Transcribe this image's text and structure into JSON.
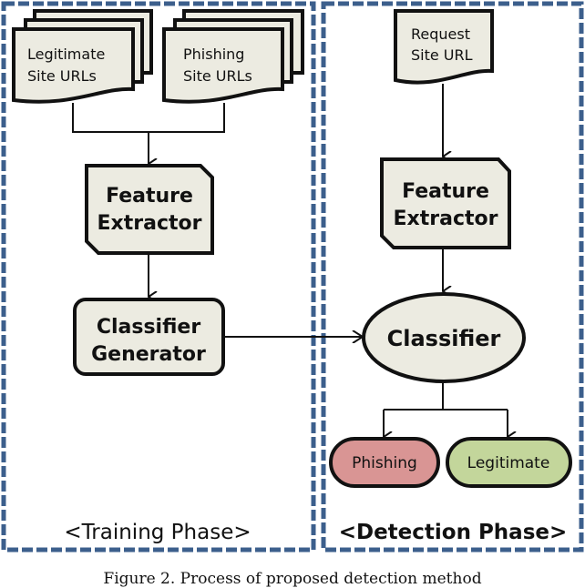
{
  "training_phase": {
    "title": "<Training Phase>",
    "legitimate_urls": {
      "line1": "Legitimate",
      "line2": "Site URLs"
    },
    "phishing_urls": {
      "line1": "Phishing",
      "line2": "Site URLs"
    },
    "feature_extractor": {
      "line1": "Feature",
      "line2": "Extractor"
    },
    "classifier_generator": {
      "line1": "Classifier",
      "line2": "Generator"
    }
  },
  "detection_phase": {
    "title": "<Detection Phase>",
    "request_url": {
      "line1": "Request",
      "line2": "Site URL"
    },
    "feature_extractor": {
      "line1": "Feature",
      "line2": "Extractor"
    },
    "classifier": "Classifier",
    "outcomes": {
      "phishing": "Phishing",
      "legitimate": "Legitimate"
    }
  },
  "colors": {
    "frame": "#3c5f8c",
    "box_fill": "#ecebe1",
    "phishing_fill": "#d99594",
    "legitimate_fill": "#c3d69b"
  },
  "caption": "Figure 2.  Process of proposed detection method"
}
